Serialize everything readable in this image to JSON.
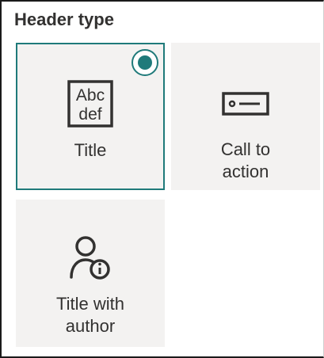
{
  "header": {
    "title": "Header type"
  },
  "options": [
    {
      "label": "Title",
      "icon": "text-abc-def-icon",
      "selected": true
    },
    {
      "label": "Call to\naction",
      "icon": "call-to-action-icon",
      "selected": false
    },
    {
      "label": "Title with\nauthor",
      "icon": "person-info-icon",
      "selected": false
    }
  ],
  "colors": {
    "accent": "#1f7a7a",
    "card_background": "#f3f2f1",
    "text": "#323130"
  }
}
